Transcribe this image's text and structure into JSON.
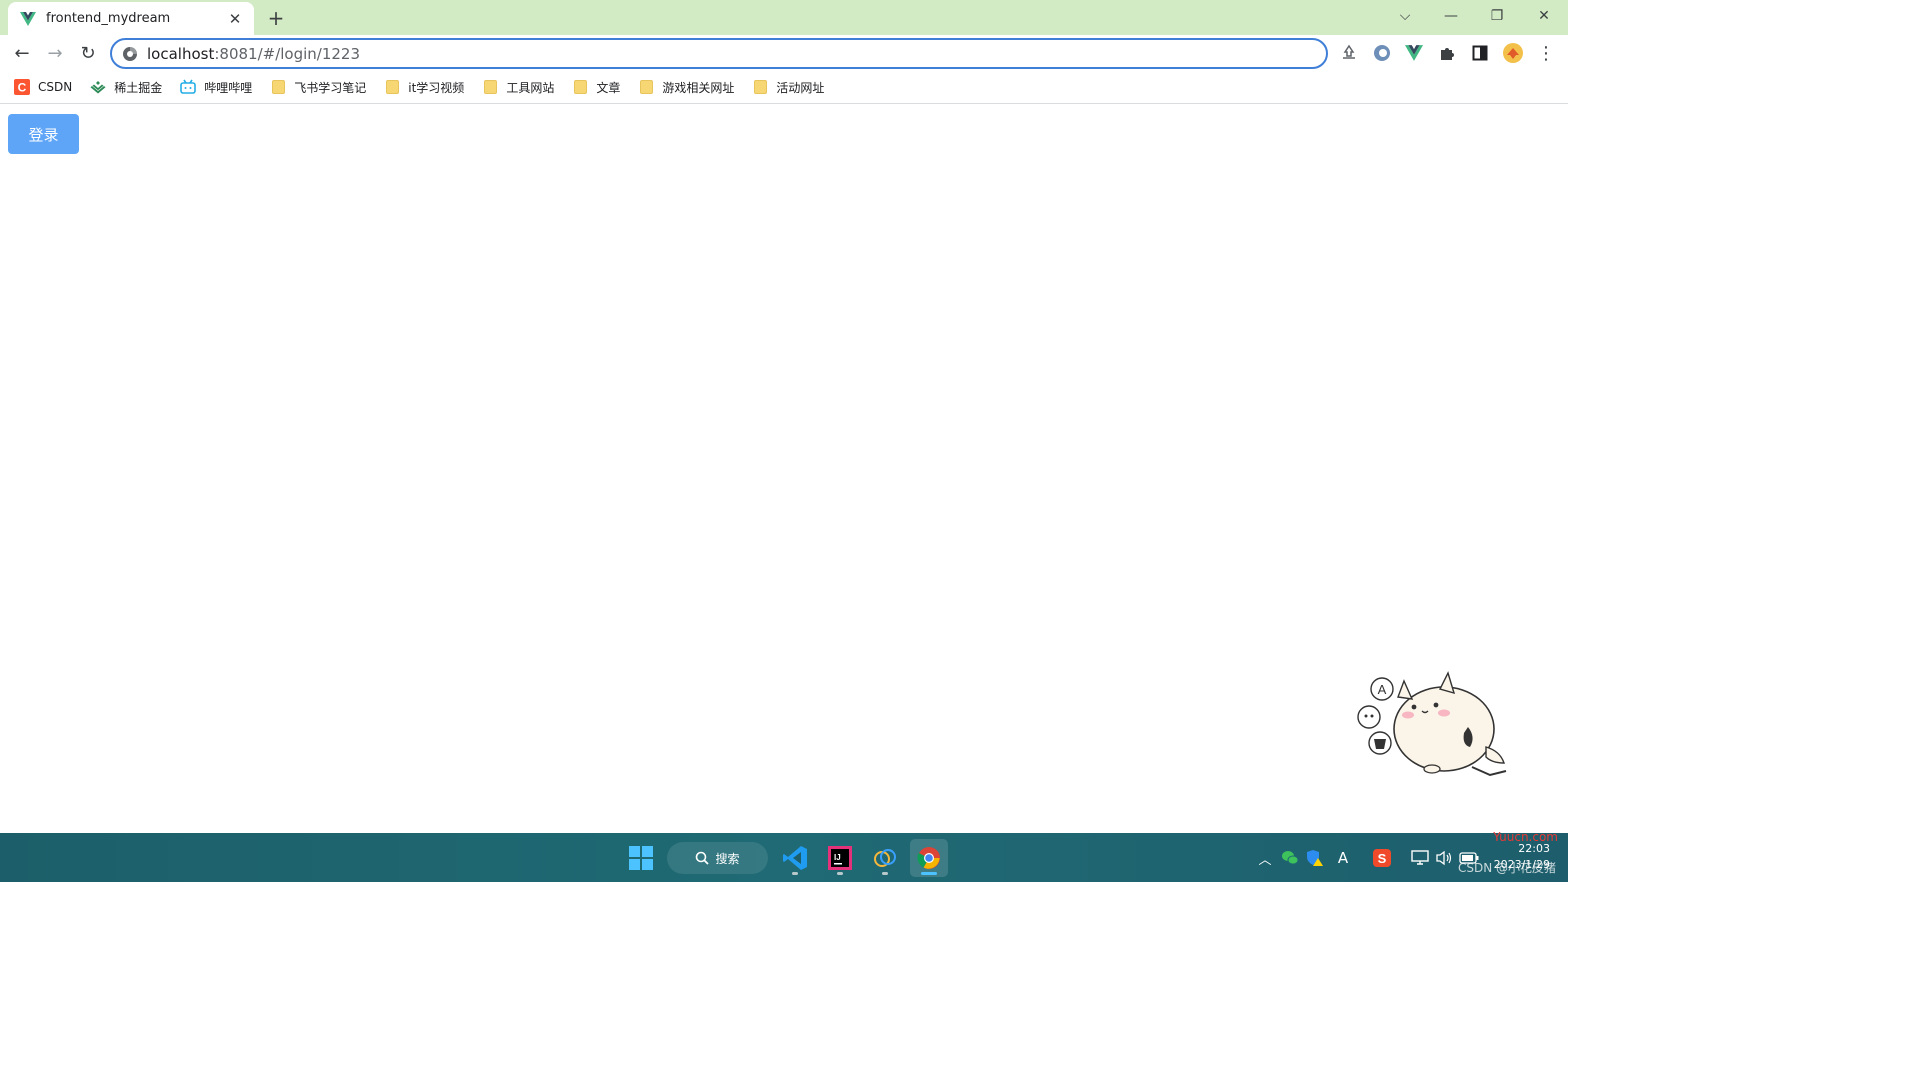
{
  "browser": {
    "tab": {
      "title": "frontend_mydream",
      "close_glyph": "✕",
      "favicon": "vue-icon"
    },
    "new_tab_glyph": "+",
    "window_controls": {
      "tab_search": "⌵",
      "minimize": "—",
      "restore": "❐",
      "close": "✕"
    },
    "toolbar": {
      "back": "←",
      "forward": "→",
      "reload": "↻",
      "url_host": "localhost",
      "url_path": ":8081/#/login/1223",
      "extensions": [
        "recycle-icon",
        "circle-extension-icon",
        "vue-devtools-icon",
        "puzzle-icon",
        "side-panel-icon",
        "profile-avatar-icon",
        "kebab-menu-icon"
      ],
      "menu_glyph": "⋮"
    },
    "bookmarks": [
      {
        "label": "CSDN",
        "icon": "csdn-icon",
        "color": "#fc5531"
      },
      {
        "label": "稀土掘金",
        "icon": "juejin-icon",
        "color": "#1e80ff"
      },
      {
        "label": "哔哩哔哩",
        "icon": "bilibili-icon",
        "color": "#23ade5"
      },
      {
        "label": "飞书学习笔记",
        "icon": "folder-icon"
      },
      {
        "label": "it学习视频",
        "icon": "folder-icon"
      },
      {
        "label": "工具网站",
        "icon": "folder-icon"
      },
      {
        "label": "文章",
        "icon": "folder-icon"
      },
      {
        "label": "游戏相关网址",
        "icon": "folder-icon"
      },
      {
        "label": "活动网址",
        "icon": "folder-icon"
      }
    ]
  },
  "page": {
    "login_button": "登录",
    "accent": "#5ea5f7"
  },
  "taskbar": {
    "search_label": "搜索",
    "apps": [
      "windows-start-icon",
      "vscode-icon",
      "intellij-icon",
      "app-icon",
      "chrome-icon"
    ],
    "tray": {
      "chevron": "︿",
      "ime": "A",
      "time": "22:03",
      "date": "2023/1/29"
    },
    "watermark": "CSDN @小花皮猪",
    "watermark_red": "Yuucn.com"
  }
}
